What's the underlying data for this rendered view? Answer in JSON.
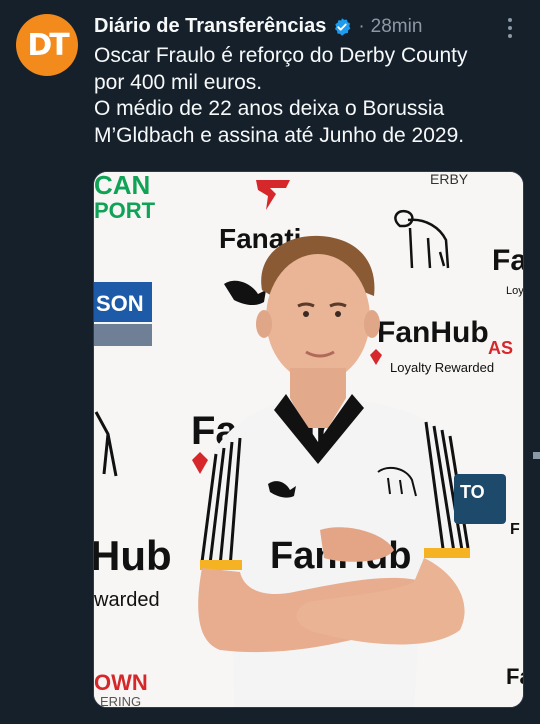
{
  "account": {
    "name": "Diário de Transferências",
    "verified": true,
    "separator": "·",
    "timestamp": "28min",
    "avatar_icon": "dt-logo-icon",
    "avatar_color": "#f28a1c"
  },
  "tweet": {
    "lines": [
      "Oscar Fraulo é reforço do Derby County",
      "por 400 mil euros.",
      "O médio de 22 anos deixa o Borussia",
      "M’Gldbach e assina até Junho de 2029."
    ]
  },
  "media": {
    "backdrop_texts": {
      "top_left_1": "CAN",
      "top_left_2": "PORT",
      "fanatics": "Fanati",
      "top_right": "ERBY",
      "son": "SON",
      "fanhub_right": "FanHub",
      "loyalty": "Loyalty Rewarded",
      "fanhub_mid": "FanHub",
      "fanhub_left_partial": "Fan",
      "hub_left": "Hub",
      "rewarded_left": "warded",
      "own": "OWN",
      "ering": "ERING",
      "right_fan": "Fa",
      "right_loy": "Loy",
      "as": "AS",
      "shirt_sponsor": "FanHub",
      "sleeve_text": "TO"
    },
    "colors": {
      "backdrop": "#f3f2ef",
      "green": "#10a356",
      "blue": "#1d5ba8",
      "red": "#d6282b"
    }
  }
}
